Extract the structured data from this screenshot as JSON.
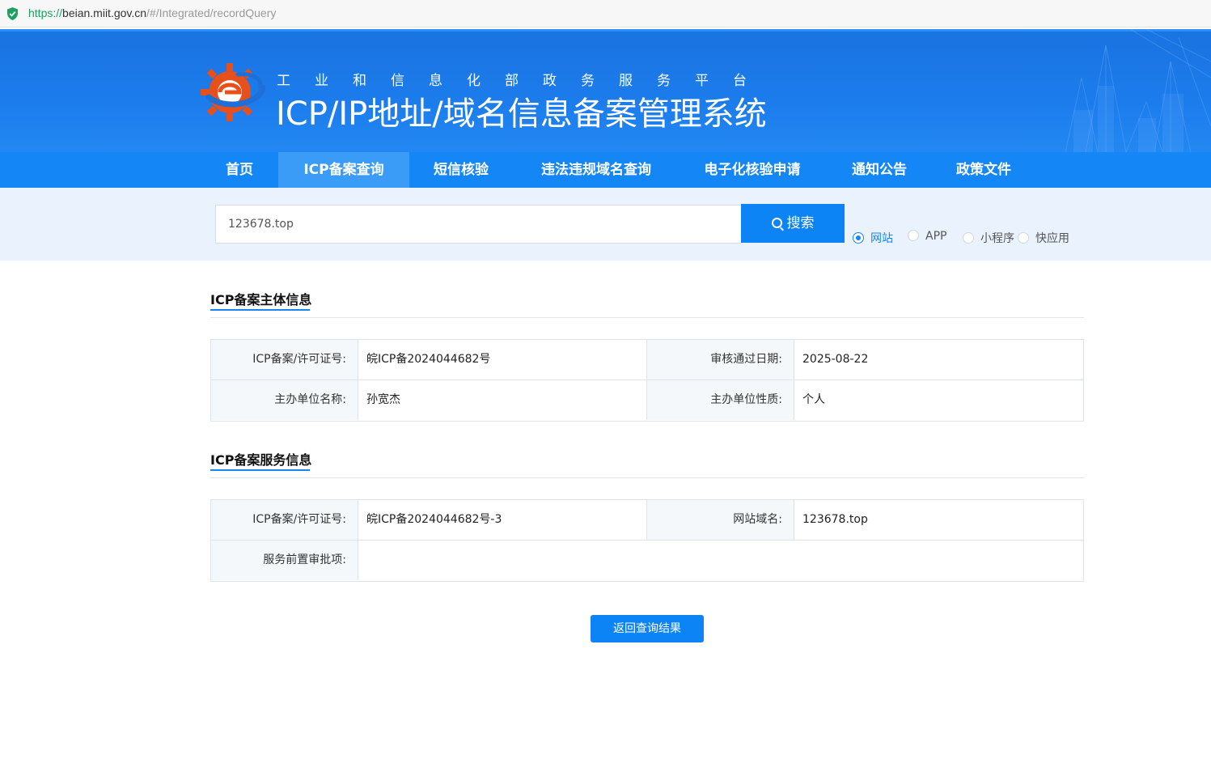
{
  "address_bar": {
    "scheme": "https://",
    "host": "beian.miit.gov.cn",
    "path": "/#/Integrated/recordQuery"
  },
  "header": {
    "subtitle": "工业和信息化部政务服务平台",
    "title": "ICP/IP地址/域名信息备案管理系统",
    "brand_color": "#1c7cec"
  },
  "nav": {
    "items": [
      {
        "label": "首页"
      },
      {
        "label": "ICP备案查询"
      },
      {
        "label": "短信核验"
      },
      {
        "label": "违法违规域名查询"
      },
      {
        "label": "电子化核验申请"
      },
      {
        "label": "通知公告"
      },
      {
        "label": "政策文件"
      }
    ],
    "active": "ICP备案查询"
  },
  "search": {
    "value": "123678.top",
    "button_label": "搜索",
    "types": [
      {
        "label": "网站",
        "checked": true
      },
      {
        "label": "APP",
        "checked": false
      },
      {
        "label": "小程序",
        "checked": false
      },
      {
        "label": "快应用",
        "checked": false
      }
    ]
  },
  "subject_info": {
    "title": "ICP备案主体信息",
    "license_label": "ICP备案/许可证号:",
    "license_value": "皖ICP备2024044682号",
    "approve_date_label": "审核通过日期:",
    "approve_date_value": "2025-08-22",
    "org_name_label": "主办单位名称:",
    "org_name_value": "孙宽杰",
    "org_type_label": "主办单位性质:",
    "org_type_value": "个人"
  },
  "service_info": {
    "title": "ICP备案服务信息",
    "license_label": "ICP备案/许可证号:",
    "license_value": "皖ICP备2024044682号-3",
    "domain_label": "网站域名:",
    "domain_value": "123678.top",
    "pre_approval_label": "服务前置审批项:",
    "pre_approval_value": ""
  },
  "actions": {
    "back_label": "返回查询结果"
  }
}
